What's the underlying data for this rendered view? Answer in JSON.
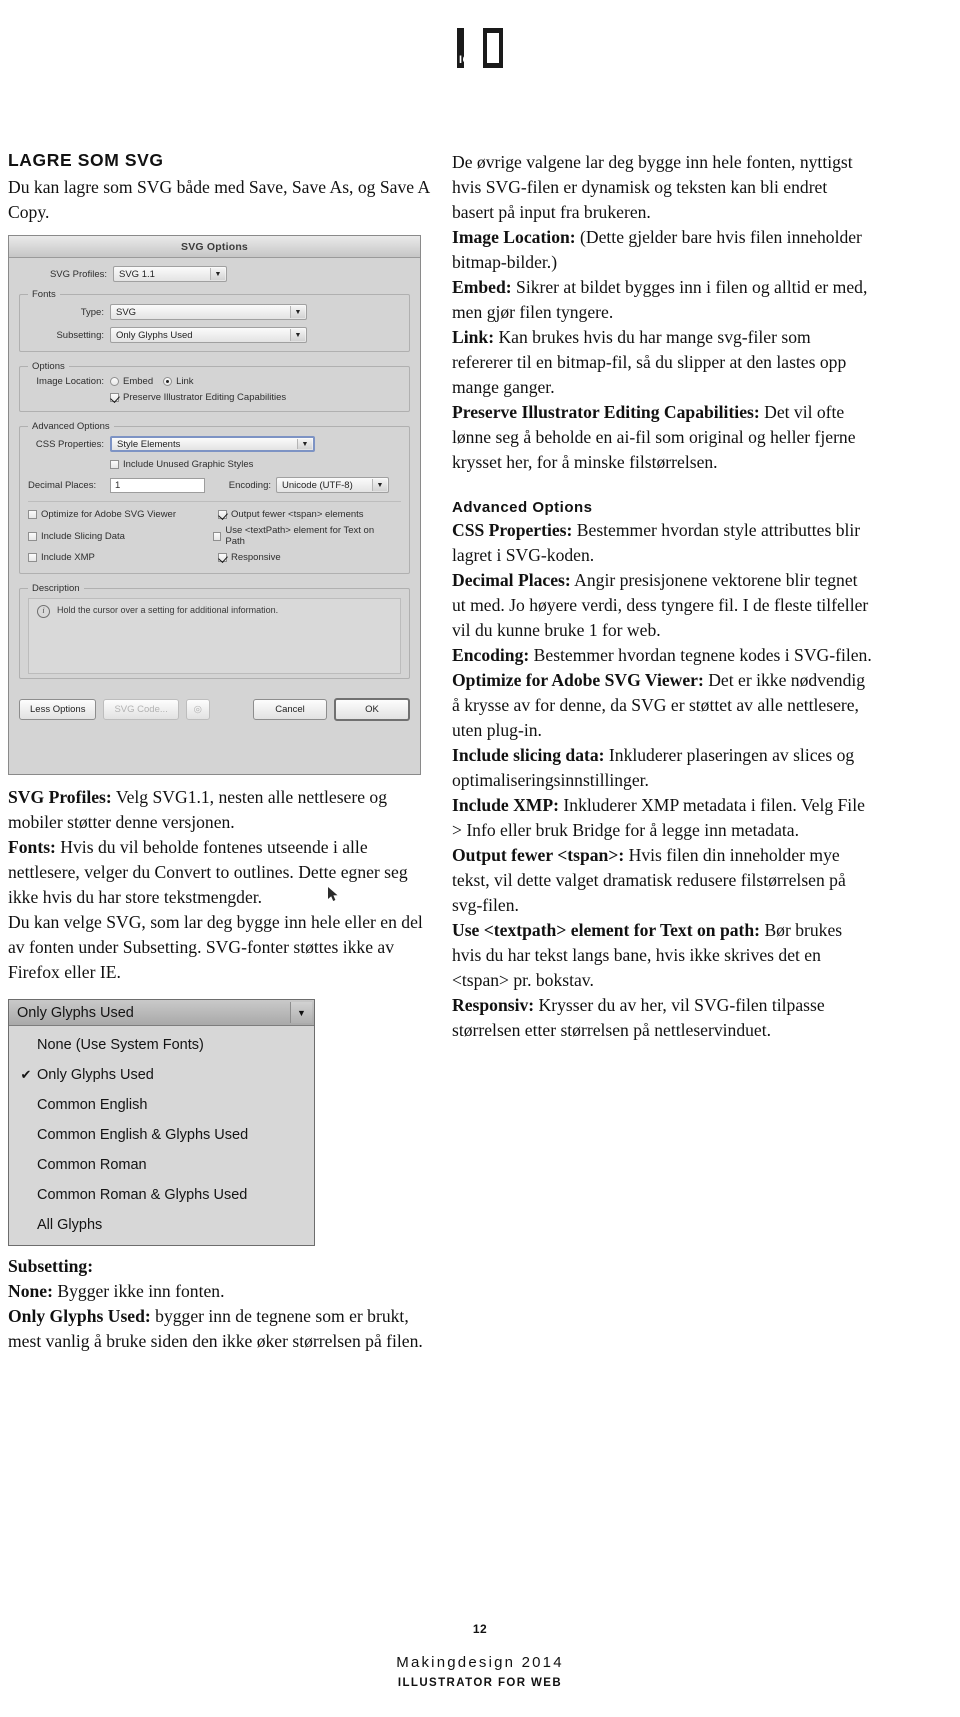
{
  "logo": {
    "text": "IGM"
  },
  "left_column": {
    "heading": "LAGRE SOM SVG",
    "intro": "Du kan lagre som SVG både med Save, Save As, og Save A Copy.",
    "after_dialog": [
      {
        "term": "SVG Profiles:",
        "text": " Velg SVG1.1, nesten alle nettlesere og mobiler støtter denne versjonen."
      },
      {
        "term": "Fonts:",
        "text": " Hvis du vil beholde fontenes utseende i alle nettlesere, velger du Convert to outlines. Dette egner seg ikke hvis du har store tekstmengder."
      },
      {
        "term": "",
        "text": "Du kan velge SVG, som lar deg bygge inn hele eller en del av fonten under Subsetting. SVG-fonter støttes ikke av Firefox eller IE."
      }
    ],
    "after_dropdown": [
      {
        "term": "Subsetting:",
        "text": ""
      },
      {
        "term": "None:",
        "text": " Bygger ikke inn fonten."
      },
      {
        "term": "Only Glyphs Used:",
        "text": " bygger inn de tegnene som er brukt, mest vanlig å bruke siden den ikke øker størrelsen på filen."
      }
    ]
  },
  "dialog": {
    "title": "SVG Options",
    "svg_profiles_label": "SVG Profiles:",
    "svg_profiles_value": "SVG 1.1",
    "fonts_group": "Fonts",
    "type_label": "Type:",
    "type_value": "SVG",
    "subsetting_label": "Subsetting:",
    "subsetting_value": "Only Glyphs Used",
    "options_group": "Options",
    "image_location_label": "Image Location:",
    "embed_label": "Embed",
    "link_label": "Link",
    "preserve_label": "Preserve Illustrator Editing Capabilities",
    "advanced_group": "Advanced Options",
    "css_properties_label": "CSS Properties:",
    "css_properties_value": "Style Elements",
    "include_unused_label": "Include Unused Graphic Styles",
    "decimal_places_label": "Decimal Places:",
    "decimal_places_value": "1",
    "encoding_label": "Encoding:",
    "encoding_value": "Unicode (UTF-8)",
    "optimize_label": "Optimize for Adobe SVG Viewer",
    "output_fewer_label": "Output fewer <tspan> elements",
    "include_slicing_label": "Include Slicing Data",
    "use_textpath_label": "Use <textPath> element for Text on Path",
    "include_xmp_label": "Include XMP",
    "responsive_label": "Responsive",
    "description_group": "Description",
    "description_text": "Hold the cursor over a setting for additional information.",
    "info_icon_glyph": "i",
    "less_options_btn": "Less Options",
    "svg_code_btn": "SVG Code...",
    "preview_btn": "◎",
    "cancel_btn": "Cancel",
    "ok_btn": "OK"
  },
  "dropdown": {
    "selected": "Only Glyphs Used",
    "arrow_glyph": "▼",
    "check_glyph": "✔",
    "items": [
      {
        "label": "None (Use System Fonts)",
        "checked": false
      },
      {
        "label": "Only Glyphs Used",
        "checked": true
      },
      {
        "label": "Common English",
        "checked": false
      },
      {
        "label": "Common English & Glyphs Used",
        "checked": false
      },
      {
        "label": "Common Roman",
        "checked": false
      },
      {
        "label": "Common Roman & Glyphs Used",
        "checked": false
      },
      {
        "label": "All Glyphs",
        "checked": false
      }
    ]
  },
  "right_column": {
    "para_intro": "De øvrige valgene lar deg bygge inn hele fonten, nyttigst hvis SVG-filen er dynamisk og teksten kan bli endret basert på input fra brukeren.",
    "entries": [
      {
        "term": "Image Location:",
        "text": " (Dette gjelder bare hvis filen inneholder bitmap-bilder.)",
        "gap": false
      },
      {
        "term": "Embed:",
        "text": " Sikrer at bildet bygges inn i filen og alltid er med, men gjør filen tyngere.",
        "gap": false
      },
      {
        "term": "Link:",
        "text": " Kan brukes hvis du har mange svg-filer som refererer til en bitmap-fil, så du slipper at den lastes opp mange ganger.",
        "gap": false
      },
      {
        "term": "Preserve Illustrator Editing Capabilities:",
        "text": " Det vil ofte lønne seg å beholde en ai-fil som original og heller fjerne krysset her, for å minske filstørrelsen.",
        "gap": true
      }
    ],
    "advanced_heading": "Advanced Options",
    "entries2": [
      {
        "term": "CSS Properties:",
        "text": " Bestemmer hvordan style attributtes blir lagret i SVG-koden.",
        "gap": false
      },
      {
        "term": "Decimal Places:",
        "text": " Angir presisjonene vektorene blir tegnet ut med. Jo høyere verdi, dess tyngere fil. I de fleste tilfeller vil du kunne bruke 1 for web.",
        "gap": true
      },
      {
        "term": "Encoding:",
        "text": " Bestemmer hvordan tegnene kodes i SVG-filen.",
        "gap": true
      },
      {
        "term": "Optimize for Adobe SVG Viewer:",
        "text": " Det er ikke nødvendig å krysse av for denne, da SVG er støttet av alle nettlesere, uten plug-in.",
        "gap": true
      },
      {
        "term": "Include slicing data:",
        "text": " Inkluderer plaseringen av slices og optimaliseringsinnstillinger.",
        "gap": true
      },
      {
        "term": "Include XMP:",
        "text": " Inkluderer XMP metadata i filen. Velg File > Info eller bruk Bridge for å legge inn metadata.",
        "gap": true
      },
      {
        "term": "Output fewer <tspan>:",
        "text": " Hvis filen din inneholder mye tekst, vil dette valget dramatisk redusere filstørrelsen på svg-filen.",
        "gap": true
      },
      {
        "term": "Use <textpath> element for Text on path:",
        "text": " Bør brukes hvis du har tekst langs bane, hvis ikke skrives det en <tspan> pr. bokstav.",
        "gap": true
      },
      {
        "term": "Responsiv:",
        "text": " Krysser du av her, vil SVG-filen tilpasse størrelsen etter størrelsen på nettleservinduet.",
        "gap": true
      }
    ]
  },
  "footer": {
    "page_number": "12",
    "brand": "Makingdesign 2014",
    "subtitle": "ILLUSTRATOR FOR WEB"
  }
}
